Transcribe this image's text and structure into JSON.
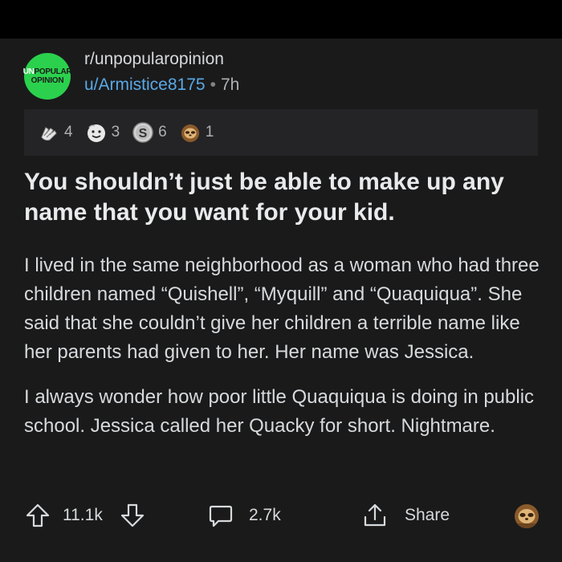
{
  "subreddit": {
    "name": "r/unpopularopinion",
    "icon_line1_prefix": "UN",
    "icon_line1_rest": "POPULAR",
    "icon_line2": "OPINION",
    "accent": "#2bd14d"
  },
  "post_meta": {
    "author": "u/Armistice8175",
    "separator": "•",
    "age": "7h"
  },
  "awards": [
    {
      "icon": "hands-award-icon",
      "count": "4"
    },
    {
      "icon": "wholesome-award-icon",
      "count": "3"
    },
    {
      "icon": "silver-award-icon",
      "count": "6"
    },
    {
      "icon": "sloth-award-icon",
      "count": "1"
    }
  ],
  "post": {
    "title": "You shouldn’t just be able to make up any name that you want for your kid.",
    "paragraphs": [
      "I lived in the same neighborhood as a woman who had three children named “Quishell”, “Myquill” and “Quaquiqua”. She said that she couldn’t give her children a terrible name like her parents had given to her. Her name was Jessica.",
      "I always wonder how poor little Quaquiqua is doing in public school. Jessica called her Quacky for short. Nightmare."
    ]
  },
  "actions": {
    "upvotes": "11.1k",
    "comments": "2.7k",
    "share_label": "Share"
  },
  "colors": {
    "background": "#1a1a1b",
    "link": "#5aa9e6",
    "text": "#d7dadc"
  }
}
